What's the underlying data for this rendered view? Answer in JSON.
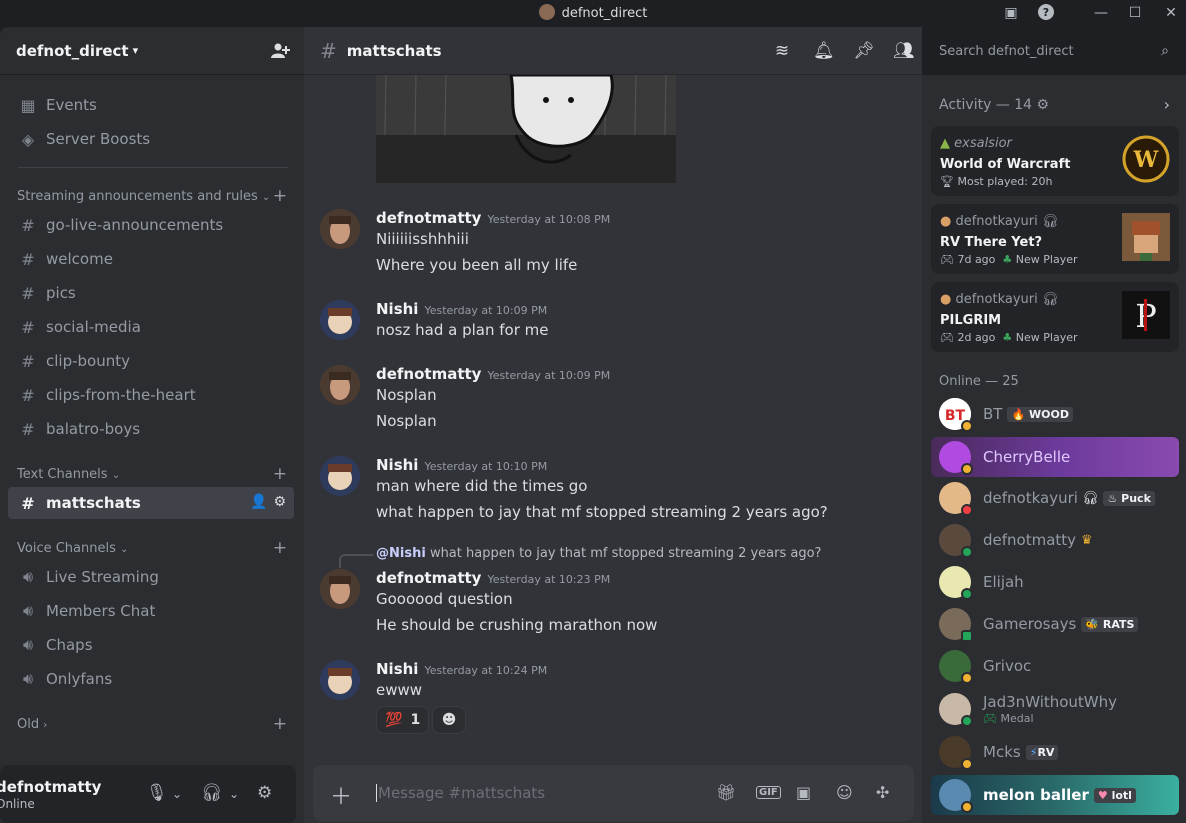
{
  "window": {
    "title": "defnot_direct"
  },
  "guild": {
    "name": "defnot_direct",
    "top_items": [
      {
        "label": "Events",
        "icon": "calendar-icon"
      },
      {
        "label": "Server Boosts",
        "icon": "boost-icon"
      }
    ],
    "categories": {
      "streaming": "Streaming announcements and rules",
      "text": "Text Channels",
      "voice": "Voice Channels",
      "old": "Old"
    },
    "streaming_channels": [
      "go-live-announcements",
      "welcome",
      "pics",
      "social-media",
      "clip-bounty",
      "clips-from-the-heart",
      "balatro-boys"
    ],
    "text_channels": [
      "mattschats"
    ],
    "voice_channels": [
      "Live Streaming",
      "Members Chat",
      "Chaps",
      "Onlyfans"
    ]
  },
  "user": {
    "name": "defnotmatty",
    "status": "Online"
  },
  "channel": {
    "name": "mattschats",
    "search_placeholder": "Search defnot_direct"
  },
  "messages": [
    {
      "author": "defnotmatty",
      "time": "Yesterday at 10:08 PM",
      "lines": [
        "Niiiiiisshhhiii",
        "Where you been all my life"
      ]
    },
    {
      "author": "Nishi",
      "time": "Yesterday at 10:09 PM",
      "lines": [
        "nosz had a plan for me"
      ]
    },
    {
      "author": "defnotmatty",
      "time": "Yesterday at 10:09 PM",
      "lines": [
        "Nosplan",
        "Nosplan"
      ]
    },
    {
      "author": "Nishi",
      "time": "Yesterday at 10:10 PM",
      "lines": [
        "man where did the times go",
        "what happen to jay that mf stopped streaming 2 years ago?"
      ]
    },
    {
      "author": "defnotmatty",
      "time": "Yesterday at 10:23 PM",
      "lines": [
        "Goooood question",
        "He should be crushing marathon now"
      ],
      "reply_mention": "@Nishi",
      "reply_text": "what happen to jay that mf stopped streaming 2 years ago?"
    },
    {
      "author": "Nishi",
      "time": "Yesterday at 10:24 PM",
      "lines": [
        "ewww"
      ],
      "reaction_emoji": "💯",
      "reaction_count": "1"
    }
  ],
  "composer": {
    "placeholder": "Message #mattschats"
  },
  "activity": {
    "title": "Activity — 14",
    "cards": [
      {
        "user": "exsalsior",
        "game": "World of Warcraft",
        "meta": "Most played: 20h",
        "meta2": ""
      },
      {
        "user": "defnotkayuri",
        "game": "RV There Yet?",
        "meta": "7d ago",
        "meta2": "New Player"
      },
      {
        "user": "defnotkayuri",
        "game": "PILGRIM",
        "meta": "2d ago",
        "meta2": "New Player"
      }
    ]
  },
  "online": {
    "title": "Online — 25",
    "members": [
      {
        "name": "BT",
        "tag": "WOOD"
      },
      {
        "name": "CherryBelle",
        "tag": ""
      },
      {
        "name": "defnotkayuri",
        "tag": "Puck"
      },
      {
        "name": "defnotmatty",
        "tag": ""
      },
      {
        "name": "Elijah",
        "tag": ""
      },
      {
        "name": "Gamerosays",
        "tag": "RATS"
      },
      {
        "name": "Grivoc",
        "tag": ""
      },
      {
        "name": "Jad3nWithoutWhy",
        "tag": "",
        "sub": "Medal"
      },
      {
        "name": "Mcks",
        "tag": "RV"
      },
      {
        "name": "melon baller",
        "tag": "lotl"
      }
    ]
  },
  "colors": {
    "accent": "#5865f2",
    "online": "#23a55a",
    "idle": "#f0b232",
    "dnd": "#f23f43"
  }
}
